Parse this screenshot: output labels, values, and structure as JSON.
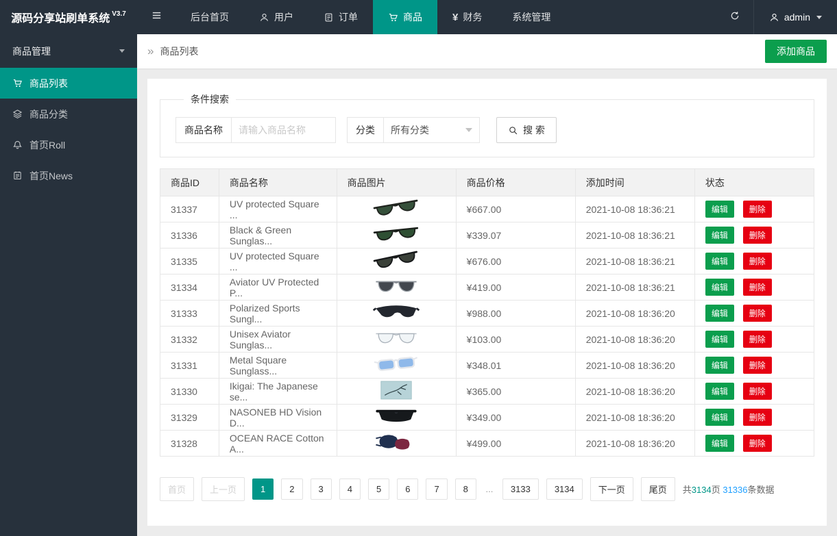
{
  "app": {
    "logo": "源码分享站刷单系统",
    "version": "V3.7"
  },
  "colors": {
    "accent_teal": "#009688",
    "button_green": "#0b9e4d",
    "danger_red": "#e60012",
    "link_blue": "#1e9fff",
    "dark_bg": "#27313c"
  },
  "header": {
    "nav": [
      {
        "label": "后台首页",
        "icon": "",
        "active": false
      },
      {
        "label": "用户",
        "icon": "user-icon",
        "active": false
      },
      {
        "label": "订单",
        "icon": "order-icon",
        "active": false
      },
      {
        "label": "商品",
        "icon": "cart-icon",
        "active": true
      },
      {
        "label": "财务",
        "icon": "yen-icon",
        "active": false
      },
      {
        "label": "系统管理",
        "icon": "",
        "active": false
      }
    ],
    "username": "admin"
  },
  "sidebar": {
    "group": "商品管理",
    "items": [
      {
        "label": "商品列表",
        "icon": "cart-icon",
        "active": true
      },
      {
        "label": "商品分类",
        "icon": "layers-icon",
        "active": false
      },
      {
        "label": "首页Roll",
        "icon": "bell-icon",
        "active": false
      },
      {
        "label": "首页News",
        "icon": "news-icon",
        "active": false
      }
    ]
  },
  "breadcrumb": {
    "current": "商品列表",
    "add_button": "添加商品"
  },
  "search": {
    "legend": "条件搜索",
    "name_label": "商品名称",
    "name_placeholder": "请输入商品名称",
    "category_label": "分类",
    "category_value": "所有分类",
    "search_button": "搜 索"
  },
  "table": {
    "columns": [
      "商品ID",
      "商品名称",
      "商品图片",
      "商品价格",
      "添加时间",
      "状态"
    ],
    "edit_label": "编辑",
    "delete_label": "删除",
    "rows": [
      {
        "id": "31337",
        "name": "UV protected Square ...",
        "image": "sunglasses-dark-tilt",
        "price": "¥667.00",
        "time": "2021-10-08 18:36:21"
      },
      {
        "id": "31336",
        "name": "Black & Green Sunglas...",
        "image": "sunglasses-green",
        "price": "¥339.07",
        "time": "2021-10-08 18:36:21"
      },
      {
        "id": "31335",
        "name": "UV protected Square ...",
        "image": "sunglasses-dark",
        "price": "¥676.00",
        "time": "2021-10-08 18:36:21"
      },
      {
        "id": "31334",
        "name": "Aviator UV Protected P...",
        "image": "aviator-sunglasses",
        "price": "¥419.00",
        "time": "2021-10-08 18:36:21"
      },
      {
        "id": "31333",
        "name": "Polarized Sports Sungl...",
        "image": "sport-sunglasses",
        "price": "¥988.00",
        "time": "2021-10-08 18:36:20"
      },
      {
        "id": "31332",
        "name": "Unisex Aviator Sunglas...",
        "image": "wire-aviator",
        "price": "¥103.00",
        "time": "2021-10-08 18:36:20"
      },
      {
        "id": "31331",
        "name": "Metal Square Sunglass...",
        "image": "blue-sunglasses",
        "price": "¥348.01",
        "time": "2021-10-08 18:36:20"
      },
      {
        "id": "31330",
        "name": "Ikigai: The Japanese se...",
        "image": "book-cover",
        "price": "¥365.00",
        "time": "2021-10-08 18:36:20"
      },
      {
        "id": "31329",
        "name": "NASONEB HD Vision D...",
        "image": "fitover-glasses",
        "price": "¥349.00",
        "time": "2021-10-08 18:36:20"
      },
      {
        "id": "31328",
        "name": "OCEAN RACE Cotton A...",
        "image": "face-masks",
        "price": "¥499.00",
        "time": "2021-10-08 18:36:20"
      }
    ]
  },
  "pagination": {
    "items": [
      {
        "label": "首页",
        "state": "disabled"
      },
      {
        "label": "上一页",
        "state": "disabled"
      },
      {
        "label": "1",
        "state": "active"
      },
      {
        "label": "2"
      },
      {
        "label": "3"
      },
      {
        "label": "4"
      },
      {
        "label": "5"
      },
      {
        "label": "6"
      },
      {
        "label": "7"
      },
      {
        "label": "8"
      },
      {
        "label": "...",
        "state": "ellipsis"
      },
      {
        "label": "3133"
      },
      {
        "label": "3134"
      },
      {
        "label": "下一页"
      },
      {
        "label": "尾页"
      }
    ],
    "summary": {
      "prefix": "共",
      "pages": "3134",
      "mid": "页 ",
      "count": "31336",
      "suffix": "条数据"
    }
  }
}
